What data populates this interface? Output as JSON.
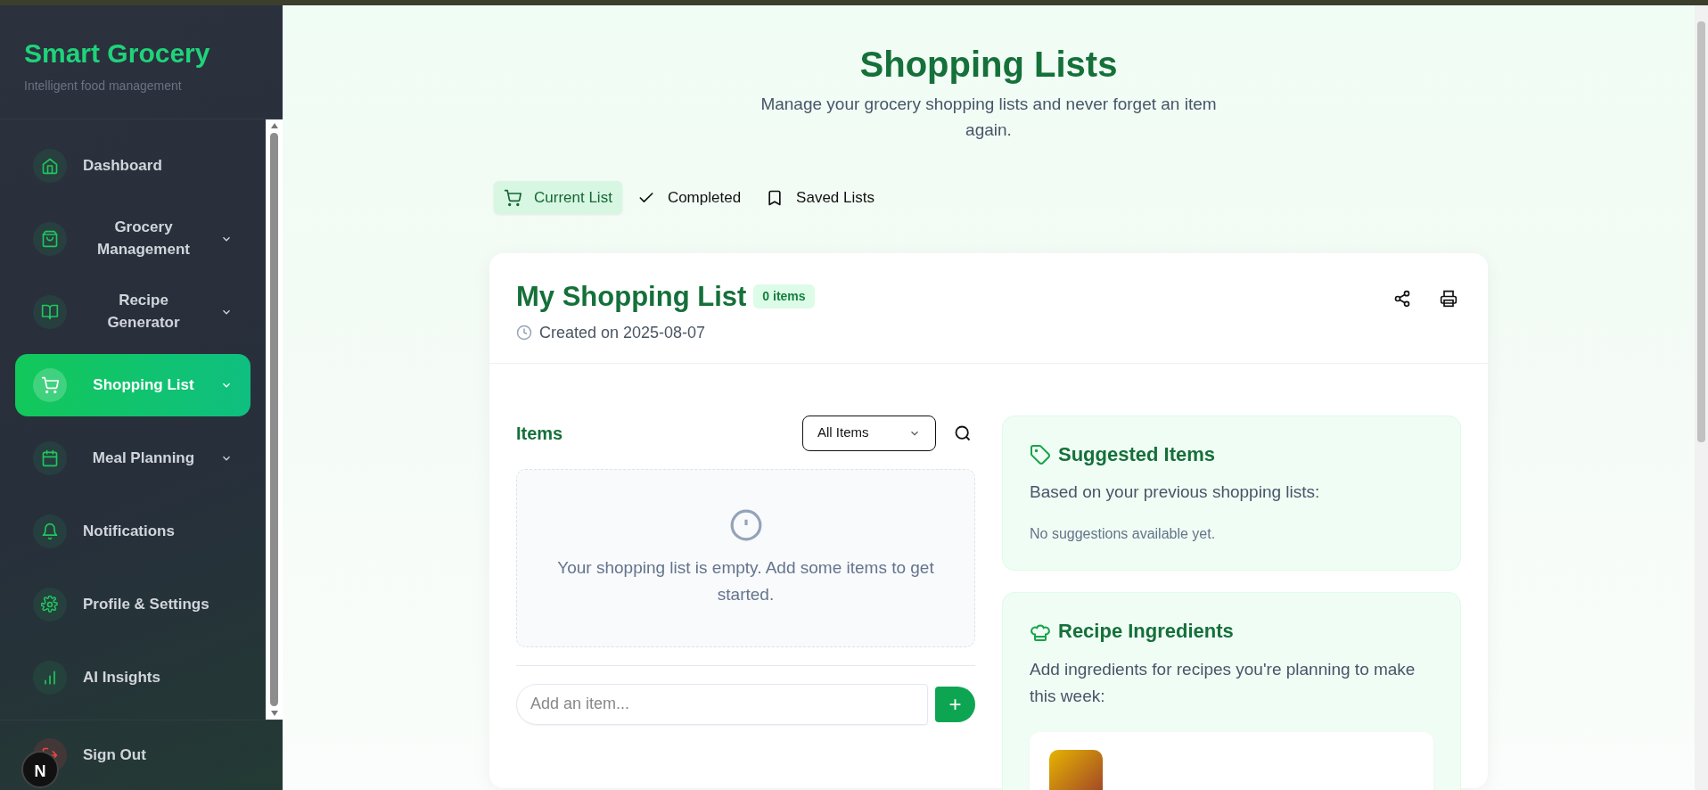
{
  "sidebar": {
    "brand": "Smart Grocery",
    "tagline": "Intelligent food management",
    "items": [
      {
        "label": "Dashboard",
        "expandable": false,
        "selected": false
      },
      {
        "label": "Grocery Management",
        "expandable": true,
        "selected": false
      },
      {
        "label": "Recipe Generator",
        "expandable": true,
        "selected": false
      },
      {
        "label": "Shopping List",
        "expandable": true,
        "selected": true
      },
      {
        "label": "Meal Planning",
        "expandable": true,
        "selected": false
      },
      {
        "label": "Notifications",
        "expandable": false,
        "selected": false
      },
      {
        "label": "Profile & Settings",
        "expandable": false,
        "selected": false
      },
      {
        "label": "AI Insights",
        "expandable": false,
        "selected": false
      }
    ],
    "sign_out": "Sign Out",
    "dev_badge": "N"
  },
  "header": {
    "title": "Shopping Lists",
    "subtitle": "Manage your grocery shopping lists and never forget an item again."
  },
  "tabs": [
    {
      "label": "Current List",
      "selected": true
    },
    {
      "label": "Completed",
      "selected": false
    },
    {
      "label": "Saved Lists",
      "selected": false
    }
  ],
  "list": {
    "title": "My Shopping List",
    "count": "0 items",
    "created": "Created on 2025-08-07",
    "items_heading": "Items",
    "filter": "All Items",
    "empty_message": "Your shopping list is empty. Add some items to get started.",
    "add_placeholder": "Add an item...",
    "add_button": "+"
  },
  "suggested": {
    "title": "Suggested Items",
    "text": "Based on your previous shopping lists:",
    "empty": "No suggestions available yet."
  },
  "recipe": {
    "title": "Recipe Ingredients",
    "text": "Add ingredients for recipes you're planning to make this week:"
  }
}
